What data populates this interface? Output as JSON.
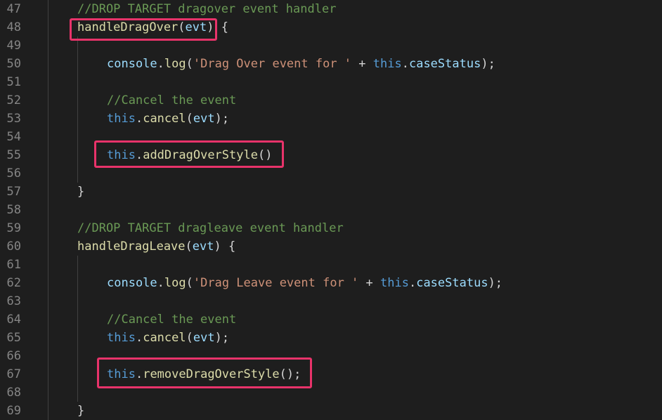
{
  "editor": {
    "lines": [
      {
        "num": "47",
        "tokens": [
          {
            "t": "//DROP TARGET dragover event handler",
            "c": "comment"
          }
        ]
      },
      {
        "num": "48",
        "tokens": [
          {
            "t": "handleDragOver",
            "c": "fn"
          },
          {
            "t": "(",
            "c": "punc"
          },
          {
            "t": "evt",
            "c": "var"
          },
          {
            "t": ")",
            "c": "punc"
          },
          {
            "t": " {",
            "c": "punc"
          }
        ]
      },
      {
        "num": "49",
        "tokens": []
      },
      {
        "num": "50",
        "tokens": [
          {
            "t": "console",
            "c": "var"
          },
          {
            "t": ".",
            "c": "punc"
          },
          {
            "t": "log",
            "c": "fn"
          },
          {
            "t": "(",
            "c": "punc"
          },
          {
            "t": "'Drag Over event for '",
            "c": "str"
          },
          {
            "t": " + ",
            "c": "punc"
          },
          {
            "t": "this",
            "c": "kw"
          },
          {
            "t": ".",
            "c": "punc"
          },
          {
            "t": "caseStatus",
            "c": "var"
          },
          {
            "t": ");",
            "c": "punc"
          }
        ]
      },
      {
        "num": "51",
        "tokens": []
      },
      {
        "num": "52",
        "tokens": [
          {
            "t": "//Cancel the event",
            "c": "comment"
          }
        ]
      },
      {
        "num": "53",
        "tokens": [
          {
            "t": "this",
            "c": "kw"
          },
          {
            "t": ".",
            "c": "punc"
          },
          {
            "t": "cancel",
            "c": "fn"
          },
          {
            "t": "(",
            "c": "punc"
          },
          {
            "t": "evt",
            "c": "var"
          },
          {
            "t": ");",
            "c": "punc"
          }
        ]
      },
      {
        "num": "54",
        "tokens": []
      },
      {
        "num": "55",
        "tokens": [
          {
            "t": "this",
            "c": "kw"
          },
          {
            "t": ".",
            "c": "punc"
          },
          {
            "t": "addDragOverStyle",
            "c": "fn"
          },
          {
            "t": "()",
            "c": "punc"
          }
        ]
      },
      {
        "num": "56",
        "tokens": []
      },
      {
        "num": "57",
        "tokens": [
          {
            "t": "}",
            "c": "punc"
          }
        ]
      },
      {
        "num": "58",
        "tokens": []
      },
      {
        "num": "59",
        "tokens": [
          {
            "t": "//DROP TARGET dragleave event handler",
            "c": "comment"
          }
        ]
      },
      {
        "num": "60",
        "tokens": [
          {
            "t": "handleDragLeave",
            "c": "fn"
          },
          {
            "t": "(",
            "c": "punc"
          },
          {
            "t": "evt",
            "c": "var"
          },
          {
            "t": ") {",
            "c": "punc"
          }
        ]
      },
      {
        "num": "61",
        "tokens": []
      },
      {
        "num": "62",
        "tokens": [
          {
            "t": "console",
            "c": "var"
          },
          {
            "t": ".",
            "c": "punc"
          },
          {
            "t": "log",
            "c": "fn"
          },
          {
            "t": "(",
            "c": "punc"
          },
          {
            "t": "'Drag Leave event for '",
            "c": "str"
          },
          {
            "t": " + ",
            "c": "punc"
          },
          {
            "t": "this",
            "c": "kw"
          },
          {
            "t": ".",
            "c": "punc"
          },
          {
            "t": "caseStatus",
            "c": "var"
          },
          {
            "t": ");",
            "c": "punc"
          }
        ]
      },
      {
        "num": "63",
        "tokens": []
      },
      {
        "num": "64",
        "tokens": [
          {
            "t": "//Cancel the event",
            "c": "comment"
          }
        ]
      },
      {
        "num": "65",
        "tokens": [
          {
            "t": "this",
            "c": "kw"
          },
          {
            "t": ".",
            "c": "punc"
          },
          {
            "t": "cancel",
            "c": "fn"
          },
          {
            "t": "(",
            "c": "punc"
          },
          {
            "t": "evt",
            "c": "var"
          },
          {
            "t": ");",
            "c": "punc"
          }
        ]
      },
      {
        "num": "66",
        "tokens": []
      },
      {
        "num": "67",
        "tokens": [
          {
            "t": "this",
            "c": "kw"
          },
          {
            "t": ".",
            "c": "punc"
          },
          {
            "t": "removeDragOverStyle",
            "c": "fn"
          },
          {
            "t": "();",
            "c": "punc"
          }
        ]
      },
      {
        "num": "68",
        "tokens": []
      },
      {
        "num": "69",
        "tokens": [
          {
            "t": "}",
            "c": "punc"
          }
        ]
      }
    ]
  },
  "colors": {
    "background": "#1e1e1e",
    "line_number": "#858585",
    "comment": "#6a9955",
    "function": "#dcdcaa",
    "variable": "#9cdcfe",
    "keyword": "#569cd6",
    "string": "#ce9178",
    "punctuation": "#d4d4d4",
    "highlight_border": "#e8336a"
  }
}
